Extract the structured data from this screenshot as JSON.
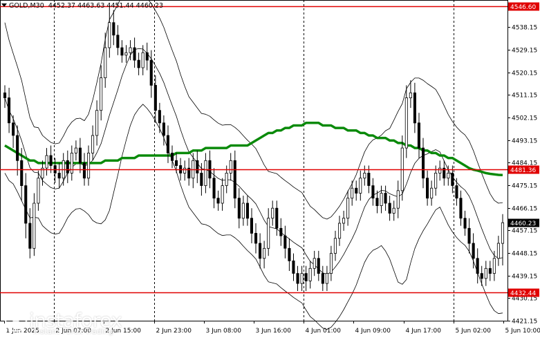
{
  "header": {
    "symbol": "GOLD,M30",
    "ohlc": "4452.37 4463.63 4451.44 4460.23"
  },
  "watermark": {
    "brand": "instaforex",
    "tagline": "Instant Forex Trading"
  },
  "colors": {
    "bull": "#000000",
    "bear": "#000000",
    "ma": "#0a8a0a",
    "bands": "#000000",
    "level": "#e00000",
    "price_tag": "#000000"
  },
  "chart_data": {
    "type": "candlestick",
    "instrument": "GOLD",
    "timeframe": "M30",
    "ylim": [
      4421.15,
      4549.0
    ],
    "y_ticks": [
      4421.15,
      4430.15,
      4439.15,
      4448.15,
      4457.15,
      4466.15,
      4475.15,
      4484.15,
      4493.15,
      4502.15,
      4511.15,
      4520.15,
      4529.15,
      4538.15,
      4547.15
    ],
    "x_ticks": [
      "1 Jun 2025",
      "2 Jun 07:00",
      "2 Jun 15:00",
      "2 Jun 23:00",
      "3 Jun 08:00",
      "3 Jun 16:00",
      "4 Jun 01:00",
      "4 Jun 09:00",
      "4 Jun 17:00",
      "5 Jun 02:00",
      "5 Jun 10:00"
    ],
    "x_tick_labels_shown": [
      "1 Jun 2025",
      "2 Jun 07:00",
      "2 Jun 15:00",
      "2 Jun 23:00",
      "3 Jun 08:00",
      "3 Jun 16:00",
      "4 Jun 01:00",
      "4 Jun 09:00",
      "4 Jun 17:00",
      "5 Jun 02:00",
      "5 Jun 10:00"
    ],
    "separators_at_ticks": [
      1,
      3,
      6,
      9
    ],
    "horizontal_levels": [
      {
        "value": 4546.6,
        "label": "4546.60"
      },
      {
        "value": 4481.36,
        "label": "4481.36"
      },
      {
        "value": 4432.44,
        "label": "4432.44"
      }
    ],
    "current_price": {
      "value": 4460.23,
      "label": "4460.23"
    },
    "close": [
      4510,
      4500,
      4495,
      4485,
      4475,
      4460,
      4450,
      4468,
      4478,
      4482,
      4487,
      4483,
      4480,
      4478,
      4485,
      4480,
      4488,
      4490,
      4484,
      4478,
      4488,
      4495,
      4505,
      4518,
      4530,
      4540,
      4535,
      4530,
      4527,
      4528,
      4530,
      4525,
      4522,
      4528,
      4525,
      4515,
      4505,
      4500,
      4495,
      4488,
      4485,
      4483,
      4480,
      4482,
      4478,
      4485,
      4480,
      4475,
      4485,
      4478,
      4470,
      4468,
      4475,
      4480,
      4485,
      4470,
      4462,
      4468,
      4462,
      4456,
      4452,
      4446,
      4450,
      4462,
      4466,
      4458,
      4455,
      4450,
      4445,
      4440,
      4436,
      4440,
      4437,
      4442,
      4446,
      4440,
      4436,
      4440,
      4448,
      4454,
      4460,
      4462,
      4470,
      4474,
      4472,
      4478,
      4480,
      4475,
      4470,
      4467,
      4472,
      4468,
      4464,
      4466,
      4473,
      4490,
      4510,
      4512,
      4500,
      4490,
      4478,
      4470,
      4474,
      4480,
      4482,
      4478,
      4480,
      4475,
      4470,
      4462,
      4458,
      4452,
      4446,
      4440,
      4438,
      4442,
      4440,
      4446,
      4452,
      4460.23
    ],
    "high_offset": [
      3,
      4,
      3,
      4,
      5,
      5,
      6,
      4,
      3,
      3,
      3,
      4,
      3,
      4,
      3,
      4,
      3,
      3,
      4,
      4,
      3,
      4,
      4,
      5,
      6,
      6,
      5,
      4,
      3,
      3,
      3,
      4,
      3,
      3,
      4,
      4,
      4,
      3,
      3,
      4,
      3,
      3,
      3,
      3,
      4,
      3,
      4,
      4,
      3,
      4,
      4,
      3,
      3,
      3,
      3,
      4,
      4,
      3,
      3,
      4,
      4,
      4,
      3,
      4,
      3,
      3,
      4,
      4,
      4,
      3,
      3,
      3,
      3,
      3,
      3,
      3,
      3,
      3,
      3,
      3,
      3,
      3,
      3,
      3,
      3,
      3,
      3,
      3,
      3,
      3,
      3,
      3,
      3,
      3,
      4,
      5,
      5,
      5,
      4,
      4,
      4,
      3,
      3,
      3,
      3,
      3,
      3,
      3,
      3,
      3,
      3,
      4,
      4,
      4,
      3,
      3,
      3,
      3,
      3,
      3.4
    ],
    "low_offset": [
      4,
      4,
      5,
      6,
      6,
      6,
      4,
      3,
      3,
      3,
      3,
      3,
      4,
      4,
      3,
      4,
      3,
      3,
      4,
      3,
      3,
      3,
      4,
      4,
      4,
      4,
      4,
      3,
      3,
      3,
      3,
      3,
      3,
      3,
      4,
      5,
      5,
      4,
      4,
      4,
      3,
      3,
      3,
      3,
      3,
      4,
      4,
      4,
      3,
      4,
      4,
      3,
      3,
      3,
      3,
      4,
      4,
      3,
      3,
      4,
      4,
      4,
      4,
      3,
      3,
      3,
      4,
      4,
      4,
      3,
      3,
      3,
      4,
      3,
      3,
      3,
      3,
      3,
      3,
      3,
      3,
      3,
      3,
      3,
      3,
      3,
      3,
      3,
      3,
      3,
      3,
      3,
      3,
      3,
      4,
      4,
      4,
      4,
      4,
      4,
      4,
      3,
      3,
      3,
      3,
      3,
      3,
      3,
      3,
      3,
      3,
      4,
      4,
      4,
      3,
      3,
      3,
      3,
      3,
      8.8
    ],
    "ma_period_shown": "long moving average",
    "ma": [
      4491,
      4490,
      4489,
      4488,
      4487,
      4486,
      4485,
      4485,
      4484,
      4484,
      4484,
      4484,
      4484,
      4484,
      4484,
      4484,
      4484,
      4484,
      4484,
      4484,
      4484,
      4484,
      4484,
      4484,
      4485,
      4485,
      4485,
      4485,
      4486,
      4486,
      4486,
      4486,
      4487,
      4487,
      4487,
      4487,
      4487,
      4487,
      4487,
      4487,
      4487,
      4488,
      4488,
      4488,
      4488,
      4489,
      4489,
      4489,
      4490,
      4490,
      4490,
      4490,
      4490,
      4490,
      4491,
      4491,
      4491,
      4491,
      4491,
      4492,
      4493,
      4494,
      4495,
      4496,
      4496,
      4497,
      4497,
      4498,
      4498,
      4499,
      4499,
      4499,
      4500,
      4500,
      4500,
      4500,
      4499,
      4499,
      4499,
      4498,
      4498,
      4498,
      4497,
      4497,
      4497,
      4496,
      4496,
      4495,
      4495,
      4494,
      4494,
      4494,
      4493,
      4493,
      4492,
      4492,
      4491,
      4491,
      4490,
      4490,
      4489,
      4489,
      4488,
      4488,
      4487,
      4487,
      4486,
      4486,
      4485,
      4484,
      4483,
      4482,
      4481.36,
      4481,
      4480.5,
      4480,
      4479.7,
      4479.5,
      4479.3,
      4479.2
    ],
    "band_width": [
      30,
      28,
      26,
      25,
      24,
      22,
      20,
      18,
      18,
      18,
      18,
      18,
      18,
      18,
      18,
      18,
      18,
      18,
      18,
      18,
      20,
      24,
      28,
      32,
      36,
      38,
      36,
      34,
      32,
      30,
      28,
      26,
      24,
      22,
      22,
      22,
      22,
      22,
      22,
      22,
      22,
      22,
      22,
      22,
      22,
      22,
      22,
      22,
      22,
      22,
      22,
      22,
      22,
      22,
      22,
      22,
      22,
      22,
      22,
      22,
      22,
      22,
      22,
      22,
      22,
      22,
      22,
      22,
      22,
      22,
      22,
      22,
      22,
      22,
      22,
      22,
      22,
      22,
      22,
      22,
      22,
      22,
      22,
      22,
      22,
      22,
      22,
      22,
      22,
      22,
      22,
      24,
      26,
      30,
      34,
      36,
      38,
      36,
      34,
      32,
      30,
      28,
      26,
      24,
      22,
      22,
      22,
      22,
      22,
      22,
      22,
      22,
      22,
      22,
      22,
      22,
      22,
      22,
      22,
      22
    ],
    "title": "",
    "xlabel": "",
    "ylabel": ""
  }
}
